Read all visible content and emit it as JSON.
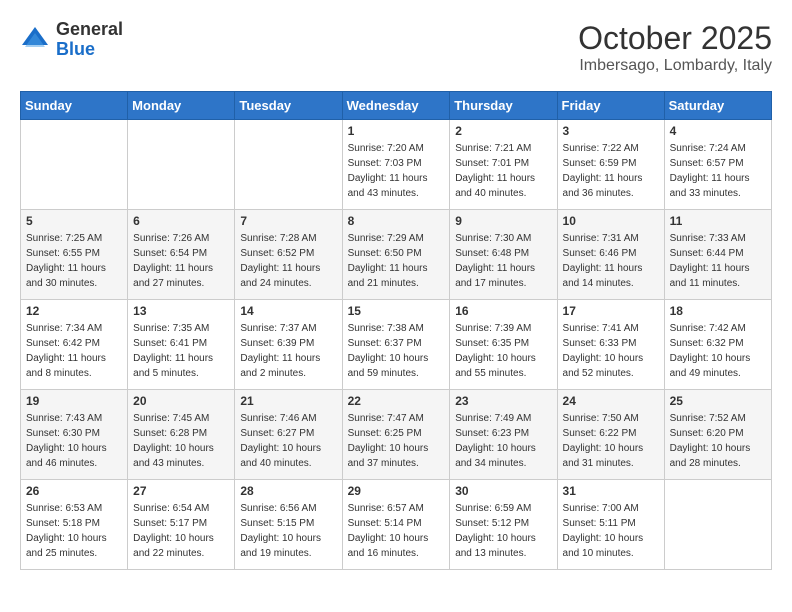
{
  "header": {
    "logo_general": "General",
    "logo_blue": "Blue",
    "month": "October 2025",
    "location": "Imbersago, Lombardy, Italy"
  },
  "days_of_week": [
    "Sunday",
    "Monday",
    "Tuesday",
    "Wednesday",
    "Thursday",
    "Friday",
    "Saturday"
  ],
  "weeks": [
    [
      {
        "day": "",
        "info": ""
      },
      {
        "day": "",
        "info": ""
      },
      {
        "day": "",
        "info": ""
      },
      {
        "day": "1",
        "info": "Sunrise: 7:20 AM\nSunset: 7:03 PM\nDaylight: 11 hours\nand 43 minutes."
      },
      {
        "day": "2",
        "info": "Sunrise: 7:21 AM\nSunset: 7:01 PM\nDaylight: 11 hours\nand 40 minutes."
      },
      {
        "day": "3",
        "info": "Sunrise: 7:22 AM\nSunset: 6:59 PM\nDaylight: 11 hours\nand 36 minutes."
      },
      {
        "day": "4",
        "info": "Sunrise: 7:24 AM\nSunset: 6:57 PM\nDaylight: 11 hours\nand 33 minutes."
      }
    ],
    [
      {
        "day": "5",
        "info": "Sunrise: 7:25 AM\nSunset: 6:55 PM\nDaylight: 11 hours\nand 30 minutes."
      },
      {
        "day": "6",
        "info": "Sunrise: 7:26 AM\nSunset: 6:54 PM\nDaylight: 11 hours\nand 27 minutes."
      },
      {
        "day": "7",
        "info": "Sunrise: 7:28 AM\nSunset: 6:52 PM\nDaylight: 11 hours\nand 24 minutes."
      },
      {
        "day": "8",
        "info": "Sunrise: 7:29 AM\nSunset: 6:50 PM\nDaylight: 11 hours\nand 21 minutes."
      },
      {
        "day": "9",
        "info": "Sunrise: 7:30 AM\nSunset: 6:48 PM\nDaylight: 11 hours\nand 17 minutes."
      },
      {
        "day": "10",
        "info": "Sunrise: 7:31 AM\nSunset: 6:46 PM\nDaylight: 11 hours\nand 14 minutes."
      },
      {
        "day": "11",
        "info": "Sunrise: 7:33 AM\nSunset: 6:44 PM\nDaylight: 11 hours\nand 11 minutes."
      }
    ],
    [
      {
        "day": "12",
        "info": "Sunrise: 7:34 AM\nSunset: 6:42 PM\nDaylight: 11 hours\nand 8 minutes."
      },
      {
        "day": "13",
        "info": "Sunrise: 7:35 AM\nSunset: 6:41 PM\nDaylight: 11 hours\nand 5 minutes."
      },
      {
        "day": "14",
        "info": "Sunrise: 7:37 AM\nSunset: 6:39 PM\nDaylight: 11 hours\nand 2 minutes."
      },
      {
        "day": "15",
        "info": "Sunrise: 7:38 AM\nSunset: 6:37 PM\nDaylight: 10 hours\nand 59 minutes."
      },
      {
        "day": "16",
        "info": "Sunrise: 7:39 AM\nSunset: 6:35 PM\nDaylight: 10 hours\nand 55 minutes."
      },
      {
        "day": "17",
        "info": "Sunrise: 7:41 AM\nSunset: 6:33 PM\nDaylight: 10 hours\nand 52 minutes."
      },
      {
        "day": "18",
        "info": "Sunrise: 7:42 AM\nSunset: 6:32 PM\nDaylight: 10 hours\nand 49 minutes."
      }
    ],
    [
      {
        "day": "19",
        "info": "Sunrise: 7:43 AM\nSunset: 6:30 PM\nDaylight: 10 hours\nand 46 minutes."
      },
      {
        "day": "20",
        "info": "Sunrise: 7:45 AM\nSunset: 6:28 PM\nDaylight: 10 hours\nand 43 minutes."
      },
      {
        "day": "21",
        "info": "Sunrise: 7:46 AM\nSunset: 6:27 PM\nDaylight: 10 hours\nand 40 minutes."
      },
      {
        "day": "22",
        "info": "Sunrise: 7:47 AM\nSunset: 6:25 PM\nDaylight: 10 hours\nand 37 minutes."
      },
      {
        "day": "23",
        "info": "Sunrise: 7:49 AM\nSunset: 6:23 PM\nDaylight: 10 hours\nand 34 minutes."
      },
      {
        "day": "24",
        "info": "Sunrise: 7:50 AM\nSunset: 6:22 PM\nDaylight: 10 hours\nand 31 minutes."
      },
      {
        "day": "25",
        "info": "Sunrise: 7:52 AM\nSunset: 6:20 PM\nDaylight: 10 hours\nand 28 minutes."
      }
    ],
    [
      {
        "day": "26",
        "info": "Sunrise: 6:53 AM\nSunset: 5:18 PM\nDaylight: 10 hours\nand 25 minutes."
      },
      {
        "day": "27",
        "info": "Sunrise: 6:54 AM\nSunset: 5:17 PM\nDaylight: 10 hours\nand 22 minutes."
      },
      {
        "day": "28",
        "info": "Sunrise: 6:56 AM\nSunset: 5:15 PM\nDaylight: 10 hours\nand 19 minutes."
      },
      {
        "day": "29",
        "info": "Sunrise: 6:57 AM\nSunset: 5:14 PM\nDaylight: 10 hours\nand 16 minutes."
      },
      {
        "day": "30",
        "info": "Sunrise: 6:59 AM\nSunset: 5:12 PM\nDaylight: 10 hours\nand 13 minutes."
      },
      {
        "day": "31",
        "info": "Sunrise: 7:00 AM\nSunset: 5:11 PM\nDaylight: 10 hours\nand 10 minutes."
      },
      {
        "day": "",
        "info": ""
      }
    ]
  ]
}
